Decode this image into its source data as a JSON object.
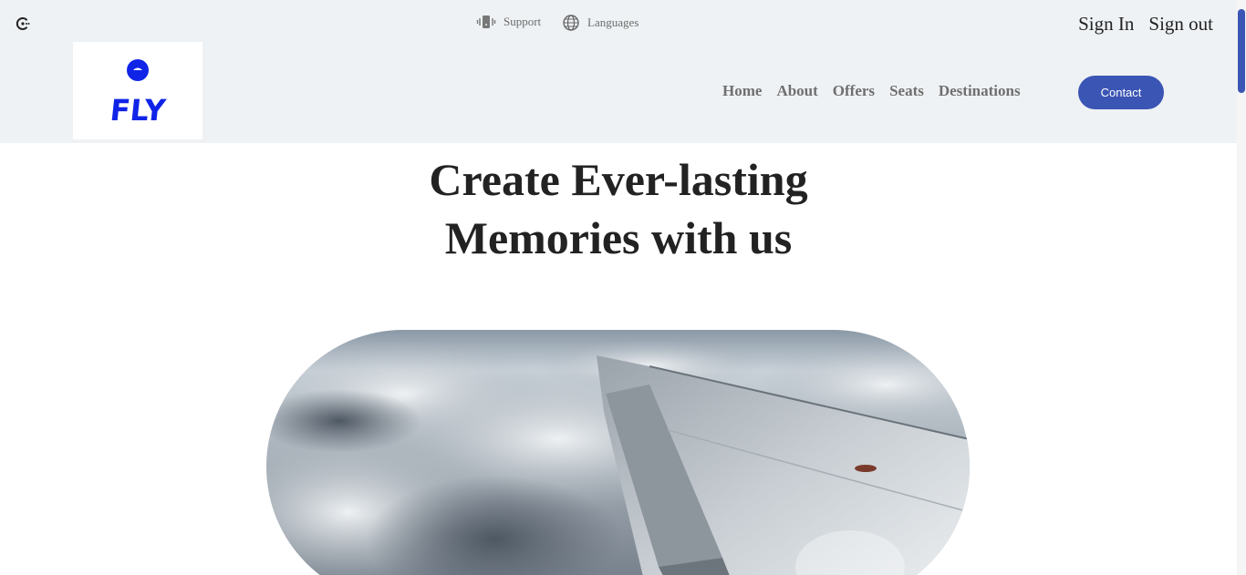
{
  "topbar": {
    "support_label": "Support",
    "languages_label": "Languages",
    "sign_in_label": "Sign In",
    "sign_out_label": "Sign out",
    "support_icon": "phone-vibrate-icon",
    "languages_icon": "globe-icon",
    "corner_icon": "refresh-icon"
  },
  "logo": {
    "text": "FLY",
    "color": "#1024e8"
  },
  "nav": {
    "items": [
      "Home",
      "About",
      "Offers",
      "Seats",
      "Destinations"
    ]
  },
  "contact_button": {
    "label": "Contact",
    "color": "#3b55b4"
  },
  "hero": {
    "title_line1": "Create Ever-lasting",
    "title_line2": "Memories with us",
    "image": "airplane-wing-above-clouds"
  },
  "colors": {
    "header_bg": "#eff2f4",
    "accent": "#3b55b4"
  }
}
